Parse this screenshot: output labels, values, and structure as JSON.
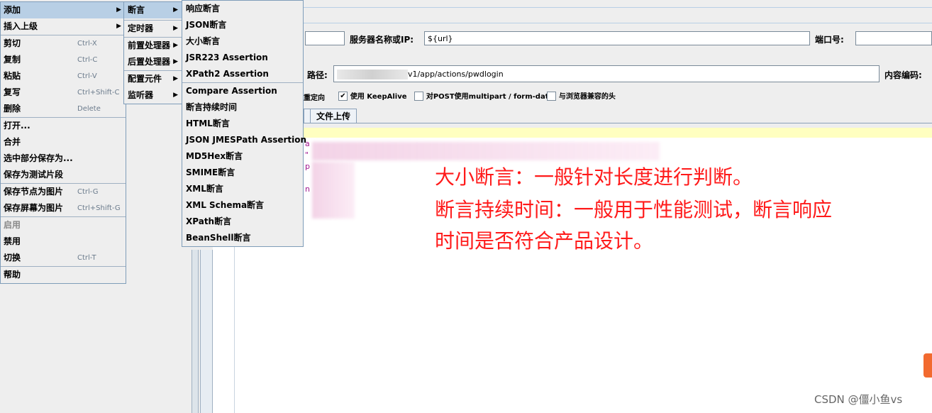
{
  "context_menu": {
    "items": [
      {
        "label": "添加",
        "shortcut": "",
        "submenu": true,
        "selected": true
      },
      {
        "label": "插入上级",
        "shortcut": "",
        "submenu": true
      },
      {
        "label": "剪切",
        "shortcut": "Ctrl-X"
      },
      {
        "label": "复制",
        "shortcut": "Ctrl-C"
      },
      {
        "label": "粘贴",
        "shortcut": "Ctrl-V"
      },
      {
        "label": "复写",
        "shortcut": "Ctrl+Shift-C"
      },
      {
        "label": "删除",
        "shortcut": "Delete"
      },
      {
        "label": "打开..."
      },
      {
        "label": "合并"
      },
      {
        "label": "选中部分保存为..."
      },
      {
        "label": "保存为测试片段"
      },
      {
        "label": "保存节点为图片",
        "shortcut": "Ctrl-G"
      },
      {
        "label": "保存屏幕为图片",
        "shortcut": "Ctrl+Shift-G"
      },
      {
        "label": "启用",
        "disabled": true
      },
      {
        "label": "禁用"
      },
      {
        "label": "切换",
        "shortcut": "Ctrl-T"
      },
      {
        "label": "帮助"
      }
    ]
  },
  "add_submenu": {
    "items": [
      {
        "label": "断言",
        "selected": true
      },
      {
        "label": "定时器"
      },
      {
        "label": "前置处理器"
      },
      {
        "label": "后置处理器"
      },
      {
        "label": "配置元件"
      },
      {
        "label": "监听器"
      }
    ]
  },
  "assertion_submenu": {
    "items": [
      "响应断言",
      "JSON断言",
      "大小断言",
      "JSR223 Assertion",
      "XPath2 Assertion",
      "Compare Assertion",
      "断言持续时间",
      "HTML断言",
      "JSON JMESPath Assertion",
      "MD5Hex断言",
      "SMIME断言",
      "XML断言",
      "XML Schema断言",
      "XPath断言",
      "BeanShell断言"
    ]
  },
  "form": {
    "server_label": "服务器名称或IP:",
    "server_value": "${url}",
    "port_label": "端口号:",
    "path_label": "路径:",
    "path_value": "v1/app/actions/pwdlogin",
    "encoding_label": "内容编码:",
    "redirect_label": "重定向",
    "keepalive_label": "使用 KeepAlive",
    "multipart_label": "对POST使用multipart / form-data",
    "browser_headers_label": "与浏览器兼容的头",
    "file_upload_tab": "文件上传"
  },
  "annotation": {
    "line1": "大小断言：一般针对长度进行判断。",
    "line2": "断言持续时间：一般用于性能测试，断言响应",
    "line3": "时间是否符合产品设计。"
  },
  "watermark": "CSDN @僵小鱼vs",
  "colors": {
    "annotation": "#ff1a1a",
    "menu_selected": "#b8cfe5",
    "highlight_bar": "#ffffc0"
  }
}
